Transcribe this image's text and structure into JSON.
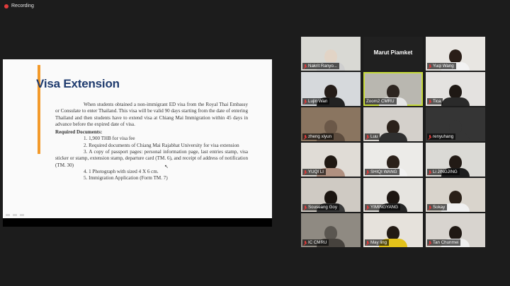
{
  "recording": {
    "label": "Recording",
    "color": "#e23b3b"
  },
  "slide": {
    "title": "Visa Extension",
    "accent_color": "#f39a2a",
    "title_color": "#1f3b6e",
    "intro": "When students obtained a non-immigrant ED visa from the Royal Thai Embassy or Consulate to enter Thailand. This visa will be valid 90 days starting from the date of entering Thailand and then students have to extend visa at Chiang Mai Immigration within 45 days in advance before the expired date of visa.",
    "required_heading": "Required Documents:",
    "items": [
      "1. 1,900 THB for visa fee",
      "2. Required documents of Chiang Mai Rajabhat University for visa extension",
      "3. A copy of passport pages: personal information page, last entries stamp, visa sticker or stamp, extension stamp, departure card (TM. 6), and receipt of address of notification (TM. 30)",
      "4. 1 Photograph with sized 4 X 6 cm.",
      "5. Immigration Application (Form TM. 7)"
    ]
  },
  "participants": [
    {
      "name": "Nakrit Ranyo...",
      "muted": true,
      "video": true,
      "bg": "#d9d9d4",
      "head": "#e2d4c6",
      "body": "#cfcfcf"
    },
    {
      "name": "Marut Piamket",
      "muted": false,
      "video": false
    },
    {
      "name": "Yuqi Wang",
      "muted": true,
      "video": true,
      "bg": "#e8e6e2",
      "head": "#2a1e18",
      "body": "#f2f2f2"
    },
    {
      "name": "Lujin Wan",
      "muted": true,
      "video": true,
      "bg": "#d6d9dc",
      "head": "#241c18",
      "body": "#222222"
    },
    {
      "name": "Zoom2 CMRU",
      "muted": false,
      "video": true,
      "active": true,
      "bg": "#b9b7b0",
      "head": "#2d2520",
      "body": "#e6e6e6"
    },
    {
      "name": "Tica",
      "muted": true,
      "video": true,
      "bg": "#e4e2e0",
      "head": "#1e1814",
      "body": "#2a2a2a"
    },
    {
      "name": "zheng xiyun",
      "muted": true,
      "video": true,
      "bg": "#8a7560",
      "head": "#6b5848",
      "body": "#5d4c3e"
    },
    {
      "name": "Luu",
      "muted": true,
      "video": true,
      "bg": "#d4d0cb",
      "head": "#2a201a",
      "body": "#2f2f2f"
    },
    {
      "name": "renyuhang",
      "muted": true,
      "video": true,
      "bg": "#353535",
      "head": "#353535",
      "body": "#353535"
    },
    {
      "name": "YUQI LI",
      "muted": true,
      "video": true,
      "bg": "#e0dcd6",
      "head": "#1f1812",
      "body": "#b09080"
    },
    {
      "name": "SHIQI WANG",
      "muted": true,
      "video": true,
      "bg": "#ecebe8",
      "head": "#2b211a",
      "body": "#f1f1f1"
    },
    {
      "name": "Li JINGJING",
      "muted": true,
      "video": true,
      "bg": "#dbdad6",
      "head": "#221a15",
      "body": "#1e1e1e"
    },
    {
      "name": "Souseang Goy",
      "muted": true,
      "video": true,
      "bg": "#cfcac3",
      "head": "#1a1410",
      "body": "#3a3a3a"
    },
    {
      "name": "YIMINGYANG",
      "muted": true,
      "video": true,
      "bg": "#e6e4e0",
      "head": "#1d1612",
      "body": "#262626"
    },
    {
      "name": "Sokay",
      "muted": true,
      "video": true,
      "bg": "#d9d4cc",
      "head": "#2a2018",
      "body": "#f0f0f0"
    },
    {
      "name": "IC CMRU",
      "muted": true,
      "video": true,
      "bg": "#8f8a82",
      "head": "#5a5650",
      "body": "#46423d"
    },
    {
      "name": "May ling",
      "muted": true,
      "video": true,
      "bg": "#e6e2dc",
      "head": "#221a14",
      "body": "#e3c21a"
    },
    {
      "name": "Tan Chunmei",
      "muted": true,
      "video": true,
      "bg": "#d8d4cf",
      "head": "#1f1813",
      "body": "#eeeeee"
    }
  ]
}
